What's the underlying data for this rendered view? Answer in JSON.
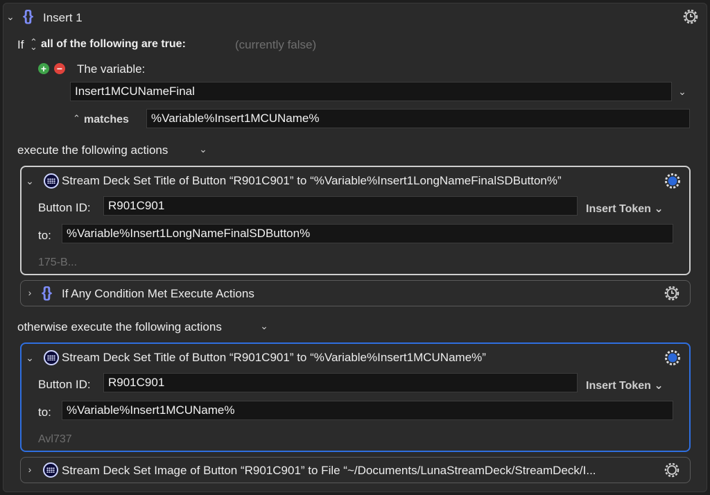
{
  "header": {
    "title": "Insert 1"
  },
  "condition": {
    "if_label": "If",
    "mode_label": "all of the following are true:",
    "status": "(currently false)",
    "variable_label": "The variable:",
    "variable_name": "Insert1MCUNameFinal",
    "operator": "matches",
    "match_value": "%Variable%Insert1MCUName%"
  },
  "then_section": {
    "label": "execute the following actions"
  },
  "otherwise_section": {
    "label": "otherwise execute the following actions"
  },
  "actions_then": [
    {
      "title": "Stream Deck Set Title of Button “R901C901” to “%Variable%Insert1LongNameFinalSDButton%”",
      "button_id_label": "Button ID:",
      "button_id": "R901C901",
      "insert_token": "Insert Token",
      "to_label": "to:",
      "to_value": "%Variable%Insert1LongNameFinalSDButton%",
      "note": "175-B..."
    },
    {
      "title": "If Any Condition Met Execute Actions"
    }
  ],
  "actions_otherwise": [
    {
      "title": "Stream Deck Set Title of Button “R901C901” to “%Variable%Insert1MCUName%”",
      "button_id_label": "Button ID:",
      "button_id": "R901C901",
      "insert_token": "Insert Token",
      "to_label": "to:",
      "to_value": "%Variable%Insert1MCUName%",
      "note": "Avl737"
    },
    {
      "title": "Stream Deck Set Image of Button “R901C901” to File “~/Documents/LunaStreamDeck/StreamDeck/I..."
    }
  ],
  "colors": {
    "accent_blue": "#2f6fe0",
    "braces": "#7d8cf7",
    "plus_green": "#3fa34a",
    "minus_red": "#e0433c"
  }
}
